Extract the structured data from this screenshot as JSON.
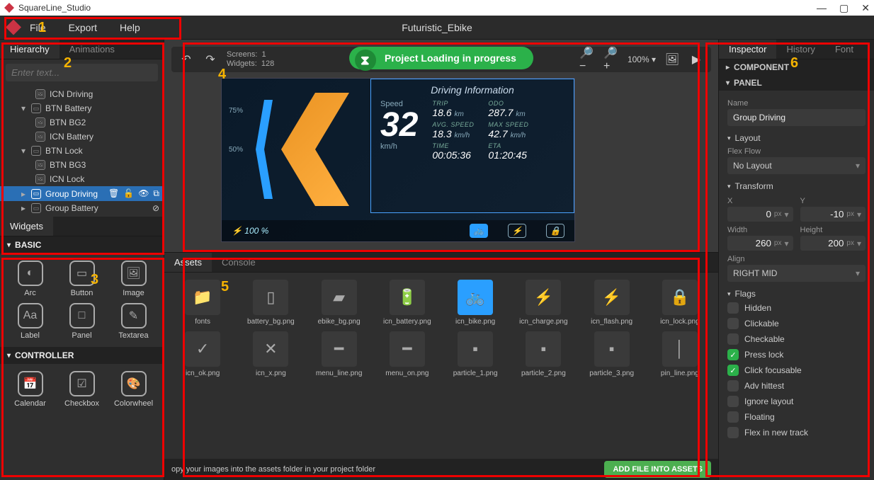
{
  "window": {
    "title": "SquareLine_Studio"
  },
  "menu": {
    "file": "File",
    "export": "Export",
    "help": "Help",
    "project_title": "Futuristic_Ebike"
  },
  "annotations": {
    "1": "1",
    "2": "2",
    "3": "3",
    "4": "4",
    "5": "5",
    "6": "6"
  },
  "hierarchy": {
    "tab_hierarchy": "Hierarchy",
    "tab_animations": "Animations",
    "search_placeholder": "Enter text...",
    "items": [
      {
        "label": "ICN Driving",
        "indent": 2,
        "icon": "img"
      },
      {
        "label": "BTN Battery",
        "indent": 1,
        "icon": "panel",
        "exp": "▾"
      },
      {
        "label": "BTN BG2",
        "indent": 2,
        "icon": "img"
      },
      {
        "label": "ICN Battery",
        "indent": 2,
        "icon": "img"
      },
      {
        "label": "BTN Lock",
        "indent": 1,
        "icon": "panel",
        "exp": "▾"
      },
      {
        "label": "BTN BG3",
        "indent": 2,
        "icon": "img"
      },
      {
        "label": "ICN Lock",
        "indent": 2,
        "icon": "img"
      },
      {
        "label": "Group Driving",
        "indent": 1,
        "icon": "panel",
        "exp": "▸",
        "selected": true,
        "actions": true
      },
      {
        "label": "Group Battery",
        "indent": 1,
        "icon": "panel",
        "exp": "▸",
        "eye": true
      }
    ]
  },
  "widgets": {
    "tab": "Widgets",
    "groups": [
      {
        "title": "BASIC",
        "items": [
          "Arc",
          "Button",
          "Image",
          "Label",
          "Panel",
          "Textarea"
        ]
      },
      {
        "title": "CONTROLLER",
        "items": [
          "Calendar",
          "Checkbox",
          "Colorwheel"
        ]
      }
    ]
  },
  "canvas": {
    "screens_label": "Screens:",
    "screens": "1",
    "widgets_label": "Widgets:",
    "widgets": "128",
    "zoom": "100%",
    "loading": "Project Loading in progress"
  },
  "preview": {
    "driving_info": "Driving Information",
    "speed_label": "Speed",
    "speed_value": "32",
    "speed_unit": "km/h",
    "pct_75": "75%",
    "pct_50": "50%",
    "battery": "⚡ 100 %",
    "stats": {
      "trip_lbl": "TRIP",
      "trip_val": "18.6",
      "trip_unit": "km",
      "odo_lbl": "ODO",
      "odo_val": "287.7",
      "odo_unit": "km",
      "avgspeed_lbl": "AVG. SPEED",
      "avgspeed_val": "18.3",
      "avgspeed_unit": "km/h",
      "maxspeed_lbl": "MAX SPEED",
      "maxspeed_val": "42.7",
      "maxspeed_unit": "km/h",
      "time_lbl": "TIME",
      "time_val": "00:05:36",
      "eta_lbl": "ETA",
      "eta_val": "01:20:45"
    }
  },
  "assets": {
    "tab_assets": "Assets",
    "tab_console": "Console",
    "items": [
      "fonts",
      "battery_bg.png",
      "ebike_bg.png",
      "icn_battery.png",
      "icn_bike.png",
      "icn_charge.png",
      "icn_flash.png",
      "icn_lock.png",
      "icn_ok.png",
      "icn_x.png",
      "menu_line.png",
      "menu_on.png",
      "particle_1.png",
      "particle_2.png",
      "particle_3.png",
      "pin_line.png"
    ],
    "footer_hint": "opy your images into the assets folder in your project folder",
    "add_button": "ADD FILE INTO ASSETS"
  },
  "inspector": {
    "tab_inspector": "Inspector",
    "tab_history": "History",
    "tab_font": "Font",
    "section_component": "COMPONENT",
    "section_panel": "PANEL",
    "name_label": "Name",
    "name_value": "Group Driving",
    "layout_hdr": "Layout",
    "flexflow_label": "Flex Flow",
    "flexflow_value": "No Layout",
    "transform_hdr": "Transform",
    "x_label": "X",
    "x_value": "0",
    "y_label": "Y",
    "y_value": "-10",
    "width_label": "Width",
    "width_value": "260",
    "height_label": "Height",
    "height_value": "200",
    "px": "px",
    "align_label": "Align",
    "align_value": "RIGHT MID",
    "flags_hdr": "Flags",
    "flags": [
      {
        "label": "Hidden",
        "on": false
      },
      {
        "label": "Clickable",
        "on": false
      },
      {
        "label": "Checkable",
        "on": false
      },
      {
        "label": "Press lock",
        "on": true
      },
      {
        "label": "Click focusable",
        "on": true
      },
      {
        "label": "Adv hittest",
        "on": false
      },
      {
        "label": "Ignore layout",
        "on": false
      },
      {
        "label": "Floating",
        "on": false
      },
      {
        "label": "Flex in new track",
        "on": false
      }
    ]
  }
}
